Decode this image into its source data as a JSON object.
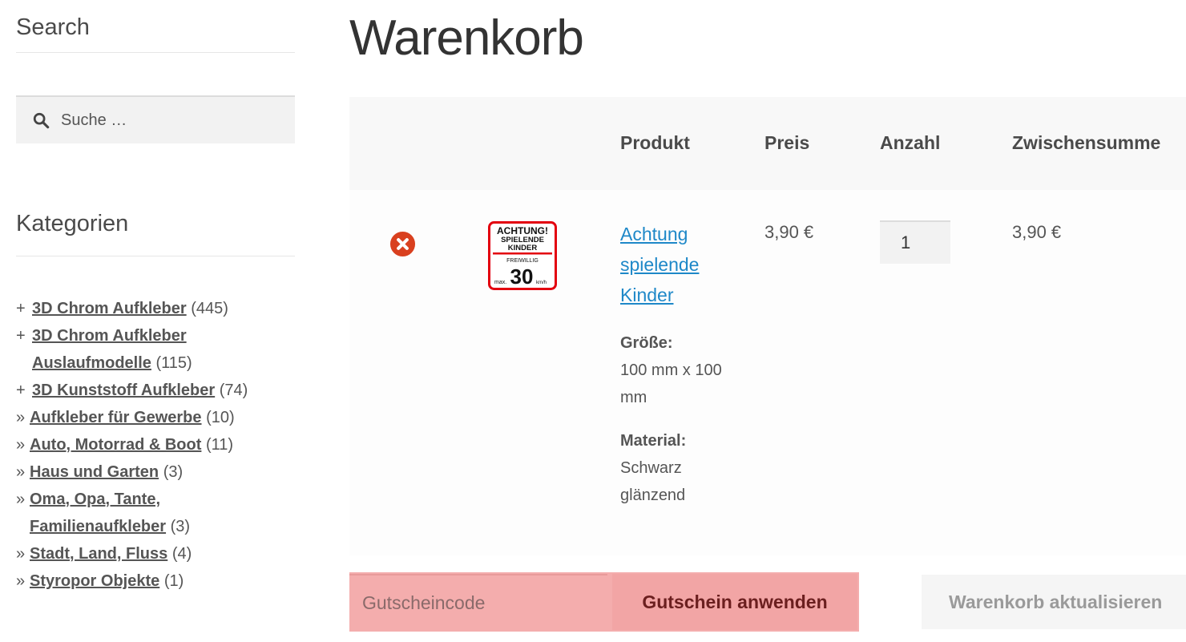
{
  "sidebar": {
    "search_title": "Search",
    "search_placeholder": "Suche …",
    "categories_title": "Kategorien",
    "categories": [
      {
        "marker": "+",
        "name": "3D Chrom Aufkleber",
        "count": "(445)"
      },
      {
        "marker": "+",
        "name": "3D Chrom Aufkleber Auslaufmodelle",
        "count": "(115)"
      },
      {
        "marker": "+",
        "name": "3D Kunststoff Aufkleber",
        "count": "(74)"
      },
      {
        "marker": "»",
        "name": "Aufkleber für Gewerbe",
        "count": "(10)"
      },
      {
        "marker": "»",
        "name": "Auto, Motorrad & Boot",
        "count": "(11)"
      },
      {
        "marker": "»",
        "name": "Haus und Garten",
        "count": "(3)"
      },
      {
        "marker": "»",
        "name": "Oma, Opa, Tante, Familienaufkleber",
        "count": "(3)"
      },
      {
        "marker": "»",
        "name": "Stadt, Land, Fluss",
        "count": "(4)"
      },
      {
        "marker": "»",
        "name": "Styropor Objekte",
        "count": "(1)"
      }
    ]
  },
  "main": {
    "title": "Warenkorb",
    "columns": {
      "product": "Produkt",
      "price": "Preis",
      "quantity": "Anzahl",
      "subtotal": "Zwischensumme"
    },
    "items": [
      {
        "name": "Achtung spielende Kinder",
        "thumbnail": {
          "line1": "ACHTUNG!",
          "line2": "SPIELENDE",
          "line3": "KINDER",
          "line4": "FREIWILLIG",
          "prefix": "max.",
          "number": "30",
          "unit": "km/h"
        },
        "attr1_label": "Größe:",
        "attr1_value": "100 mm x 100 mm",
        "attr2_label": "Material:",
        "attr2_value": "Schwarz glänzend",
        "price": "3,90 €",
        "quantity": "1",
        "subtotal": "3,90 €"
      }
    ],
    "coupon_placeholder": "Gutscheincode",
    "apply_coupon_label": "Gutschein anwenden",
    "update_cart_label": "Warenkorb aktualisieren"
  },
  "colors": {
    "link": "#1e88c8",
    "remove": "#d9401f",
    "coupon_bg": "#f4adad",
    "sign_red": "#e3000f"
  }
}
